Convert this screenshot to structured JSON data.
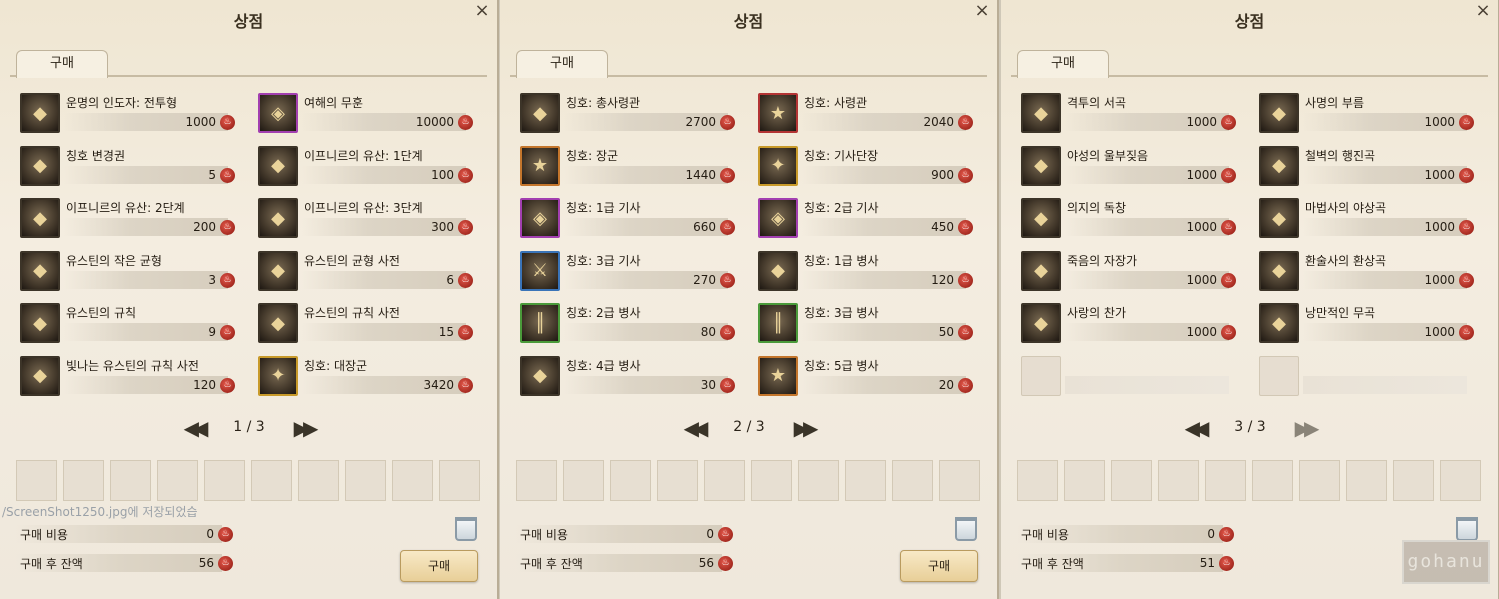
{
  "shop_title": "상점",
  "tab_label": "구매",
  "close_glyph": "×",
  "pager_first_glyph": "◀◀",
  "pager_last_glyph": "▶▶",
  "currency_glyph": "♨",
  "labels": {
    "cost": "구매 비용",
    "balance_after": "구매 후 잔액",
    "buy_button": "구매"
  },
  "panels": [
    {
      "page": "1 / 3",
      "cost": "0",
      "balance": "56",
      "items": [
        {
          "name": "운명의 인도자: 전투형",
          "price": "1000",
          "frame": "plain"
        },
        {
          "name": "여해의 무훈",
          "price": "10000",
          "frame": "purple"
        },
        {
          "name": "칭호 변경권",
          "price": "5",
          "frame": "plain"
        },
        {
          "name": "이프니르의 유산: 1단계",
          "price": "100",
          "frame": "plain"
        },
        {
          "name": "이프니르의 유산: 2단계",
          "price": "200",
          "frame": "plain"
        },
        {
          "name": "이프니르의 유산: 3단계",
          "price": "300",
          "frame": "plain"
        },
        {
          "name": "유스틴의 작은 균형",
          "price": "3",
          "frame": "plain"
        },
        {
          "name": "유스틴의 균형 사전",
          "price": "6",
          "frame": "plain"
        },
        {
          "name": "유스틴의 규칙",
          "price": "9",
          "frame": "plain"
        },
        {
          "name": "유스틴의 규칙 사전",
          "price": "15",
          "frame": "plain"
        },
        {
          "name": "빛나는 유스틴의 규칙 사전",
          "price": "120",
          "frame": "plain"
        },
        {
          "name": "칭호: 대장군",
          "price": "3420",
          "frame": "gold"
        }
      ]
    },
    {
      "page": "2 / 3",
      "cost": "0",
      "balance": "56",
      "items": [
        {
          "name": "칭호: 총사령관",
          "price": "2700",
          "frame": "plain"
        },
        {
          "name": "칭호: 사령관",
          "price": "2040",
          "frame": "red"
        },
        {
          "name": "칭호: 장군",
          "price": "1440",
          "frame": "orange"
        },
        {
          "name": "칭호: 기사단장",
          "price": "900",
          "frame": "gold"
        },
        {
          "name": "칭호: 1급 기사",
          "price": "660",
          "frame": "purple"
        },
        {
          "name": "칭호: 2급 기사",
          "price": "450",
          "frame": "purple"
        },
        {
          "name": "칭호: 3급 기사",
          "price": "270",
          "frame": "blue"
        },
        {
          "name": "칭호: 1급 병사",
          "price": "120",
          "frame": "plain"
        },
        {
          "name": "칭호: 2급 병사",
          "price": "80",
          "frame": "green"
        },
        {
          "name": "칭호: 3급 병사",
          "price": "50",
          "frame": "green"
        },
        {
          "name": "칭호: 4급 병사",
          "price": "30",
          "frame": "plain"
        },
        {
          "name": "칭호: 5급 병사",
          "price": "20",
          "frame": "orange"
        }
      ]
    },
    {
      "page": "3 / 3",
      "cost": "0",
      "balance": "51",
      "items": [
        {
          "name": "격투의 서곡",
          "price": "1000",
          "frame": "plain"
        },
        {
          "name": "사명의 부름",
          "price": "1000",
          "frame": "plain"
        },
        {
          "name": "야성의 울부짖음",
          "price": "1000",
          "frame": "plain"
        },
        {
          "name": "철벽의 행진곡",
          "price": "1000",
          "frame": "plain"
        },
        {
          "name": "의지의 독창",
          "price": "1000",
          "frame": "plain"
        },
        {
          "name": "마법사의 야상곡",
          "price": "1000",
          "frame": "plain"
        },
        {
          "name": "죽음의 자장가",
          "price": "1000",
          "frame": "plain"
        },
        {
          "name": "환술사의 환상곡",
          "price": "1000",
          "frame": "plain"
        },
        {
          "name": "사랑의 찬가",
          "price": "1000",
          "frame": "plain"
        },
        {
          "name": "낭만적인 무곡",
          "price": "1000",
          "frame": "plain"
        },
        {
          "name": "",
          "price": "",
          "frame": "empty"
        },
        {
          "name": "",
          "price": "",
          "frame": "empty"
        }
      ]
    }
  ],
  "overlay_message": "/ScreenShot1250.jpg에 저장되었습",
  "watermark_text": "gohanu"
}
